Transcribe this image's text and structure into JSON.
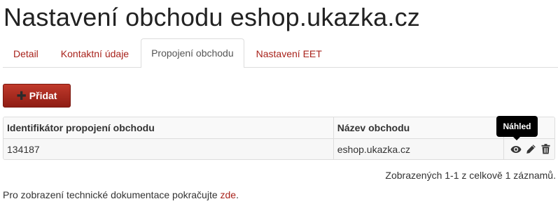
{
  "page": {
    "title": "Nastavení obchodu eshop.ukazka.cz"
  },
  "tabs": [
    {
      "label": "Detail",
      "active": false
    },
    {
      "label": "Kontaktní údaje",
      "active": false
    },
    {
      "label": "Propojení obchodu",
      "active": true
    },
    {
      "label": "Nastavení EET",
      "active": false
    }
  ],
  "toolbar": {
    "add_label": "Přidat",
    "add_icon": "plus-icon"
  },
  "table": {
    "columns": [
      "Identifikátor propojení obchodu",
      "Název obchodu"
    ],
    "rows": [
      {
        "id": "134187",
        "shop_name": "eshop.ukazka.cz",
        "actions": [
          "eye-icon",
          "pencil-icon",
          "trash-icon"
        ]
      }
    ]
  },
  "tooltip": {
    "text": "Náhled"
  },
  "pagination": {
    "info": "Zobrazených 1-1 z celkově 1 záznamů."
  },
  "footer": {
    "text": "Pro zobrazení technické dokumentace pokračujte ",
    "link_label": "zde",
    "suffix": "."
  },
  "colors": {
    "accent": "#a8221b",
    "button_top": "#c0392b",
    "button_bottom": "#8f1d14",
    "tooltip_bg": "#000000"
  }
}
